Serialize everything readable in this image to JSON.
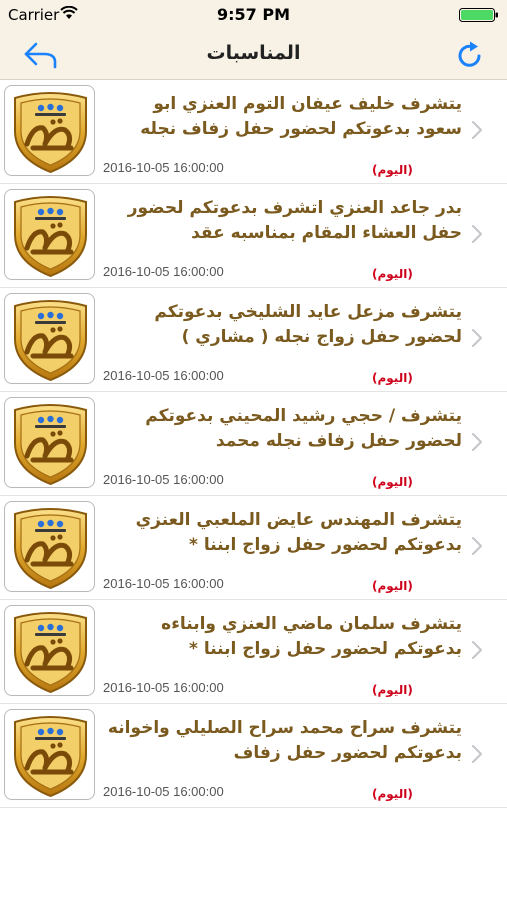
{
  "status_bar": {
    "carrier": "Carrier",
    "time": "9:57 PM"
  },
  "nav": {
    "title": "المناسبات",
    "back_icon": "back-arrow-icon",
    "refresh_icon": "refresh-icon",
    "accent_color": "#1a82fb"
  },
  "thumbnail": {
    "icon": "gold-shield-logo-icon"
  },
  "items": [
    {
      "text": "يتشرف خليف عيفان التوم العنزي ابو سعود  بدعوتكم لحضور حفل زفاف نجله",
      "date": "2016-10-05 16:00:00",
      "badge": "(اليوم)"
    },
    {
      "text": "بدر جاعد العنزي اتشرف بدعوتكم لحضور حفل  العشاء  المقام بمناسبه عقد",
      "date": "2016-10-05 16:00:00",
      "badge": "(اليوم)"
    },
    {
      "text": "يتشرف مزعل عايد الشليخي  بدعوتكم لحضور حفل زواج نجله  ( مشاري )",
      "date": "2016-10-05 16:00:00",
      "badge": "(اليوم)"
    },
    {
      "text": "يتشرف / حجي رشيد المحيني  بدعوتكم لحضور حفل زفاف نجله  محمد",
      "date": "2016-10-05 16:00:00",
      "badge": "(اليوم)"
    },
    {
      "text": "يتشرف المهندس عايض الملعبي العنزي بدعوتكم لحضور حفل زواج  ابننا *",
      "date": "2016-10-05 16:00:00",
      "badge": "(اليوم)"
    },
    {
      "text": "يتشرف سلمان ماضي العنزي وابناءه بدعوتكم لحضور حفل زواج ابننا  *",
      "date": "2016-10-05 16:00:00",
      "badge": "(اليوم)"
    },
    {
      "text": "يتشرف  سراح محمد سراح الصليلي واخوانه  بدعوتكم لحضور حفل زفاف",
      "date": "2016-10-05 16:00:00",
      "badge": "(اليوم)"
    }
  ]
}
